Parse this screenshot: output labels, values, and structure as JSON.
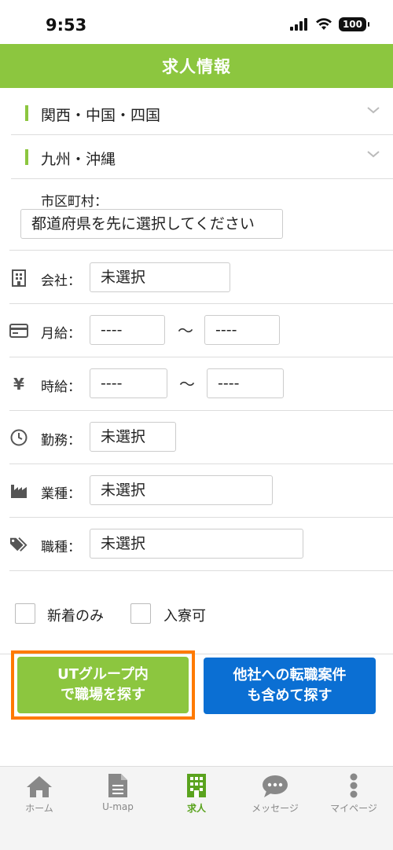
{
  "status": {
    "time": "9:53",
    "battery": "100"
  },
  "header": {
    "title": "求人情報"
  },
  "regions": [
    {
      "label": "関西・中国・四国"
    },
    {
      "label": "九州・沖縄"
    }
  ],
  "city": {
    "label": "市区町村：",
    "value": "都道府県を先に選択してください"
  },
  "fields": {
    "company": {
      "label": "会社：",
      "value": "未選択"
    },
    "monthly": {
      "label": "月給：",
      "min": "----",
      "max": "----",
      "separator": "〜"
    },
    "hourly": {
      "label": "時給：",
      "min": "----",
      "max": "----",
      "separator": "〜"
    },
    "work": {
      "label": "勤務：",
      "value": "未選択"
    },
    "industry": {
      "label": "業種：",
      "value": "未選択"
    },
    "occupation": {
      "label": "職種：",
      "value": "未選択"
    }
  },
  "checkboxes": {
    "new_only": "新着のみ",
    "dormitory": "入寮可"
  },
  "buttons": {
    "ut_search_line1": "UTグループ内",
    "ut_search_line2": "で職場を探す",
    "other_search_line1": "他社への転職案件",
    "other_search_line2": "も含めて探す"
  },
  "tabs": [
    {
      "label": "ホーム",
      "icon": "home-icon"
    },
    {
      "label": "U-map",
      "icon": "document-icon"
    },
    {
      "label": "求人",
      "icon": "building-icon",
      "active": true
    },
    {
      "label": "メッセージ",
      "icon": "chat-icon"
    },
    {
      "label": "マイページ",
      "icon": "more-icon"
    }
  ],
  "colors": {
    "accent": "#8cc63f",
    "blue": "#0b6fd3",
    "highlight": "#ff7a00"
  }
}
